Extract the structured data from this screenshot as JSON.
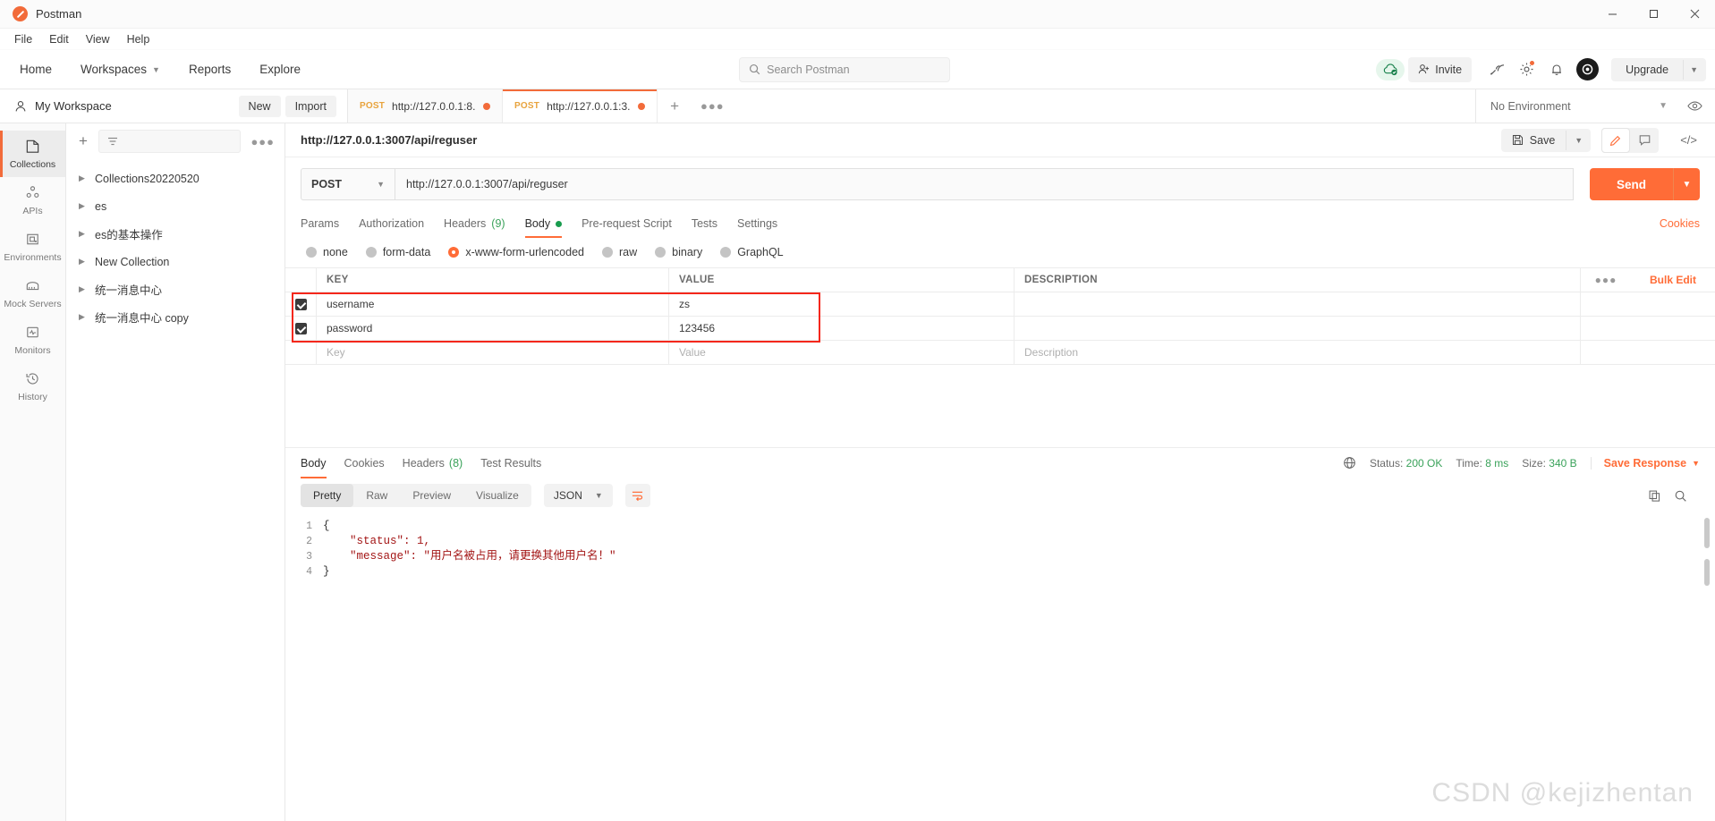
{
  "window": {
    "title": "Postman",
    "controls": {
      "minimize": "─",
      "maximize": "☐",
      "close": "✕"
    }
  },
  "menubar": {
    "items": [
      "File",
      "Edit",
      "View",
      "Help"
    ]
  },
  "navbar": {
    "links": [
      {
        "label": "Home",
        "has_chevron": false
      },
      {
        "label": "Workspaces",
        "has_chevron": true
      },
      {
        "label": "Reports",
        "has_chevron": false
      },
      {
        "label": "Explore",
        "has_chevron": false
      }
    ],
    "search_placeholder": "Search Postman",
    "invite_label": "Invite",
    "upgrade_label": "Upgrade",
    "icons": [
      "cloud-sync-icon",
      "invite-icon",
      "satellite-icon",
      "gear-icon",
      "bell-icon",
      "avatar-icon"
    ]
  },
  "workspace": {
    "name": "My Workspace",
    "new_label": "New",
    "import_label": "Import",
    "environment": "No Environment"
  },
  "request_tabs": [
    {
      "method": "POST",
      "name": "http://127.0.0.1:8...",
      "active": false,
      "unsaved": true
    },
    {
      "method": "POST",
      "name": "http://127.0.0.1:3...",
      "active": true,
      "unsaved": true
    }
  ],
  "rail": {
    "items": [
      {
        "label": "Collections",
        "icon": "collections-icon",
        "active": true
      },
      {
        "label": "APIs",
        "icon": "apis-icon",
        "active": false
      },
      {
        "label": "Environments",
        "icon": "environments-icon",
        "active": false
      },
      {
        "label": "Mock Servers",
        "icon": "mock-servers-icon",
        "active": false
      },
      {
        "label": "Monitors",
        "icon": "monitors-icon",
        "active": false
      },
      {
        "label": "History",
        "icon": "history-icon",
        "active": false
      }
    ]
  },
  "collections": {
    "filter_placeholder": "",
    "items": [
      {
        "name": "Collections20220520"
      },
      {
        "name": "es"
      },
      {
        "name": "es的基本操作"
      },
      {
        "name": "New Collection"
      },
      {
        "name": "统一消息中心"
      },
      {
        "name": "统一消息中心 copy"
      }
    ]
  },
  "request": {
    "title": "http://127.0.0.1:3007/api/reguser",
    "save_label": "Save",
    "method": "POST",
    "url": "http://127.0.0.1:3007/api/reguser",
    "send_label": "Send",
    "tabs": [
      {
        "label": "Params",
        "active": false,
        "count": null,
        "dot": false
      },
      {
        "label": "Authorization",
        "active": false,
        "count": null,
        "dot": false
      },
      {
        "label": "Headers",
        "active": false,
        "count": "(9)",
        "dot": false
      },
      {
        "label": "Body",
        "active": true,
        "count": null,
        "dot": true
      },
      {
        "label": "Pre-request Script",
        "active": false,
        "count": null,
        "dot": false
      },
      {
        "label": "Tests",
        "active": false,
        "count": null,
        "dot": false
      },
      {
        "label": "Settings",
        "active": false,
        "count": null,
        "dot": false
      }
    ],
    "cookies_link": "Cookies",
    "body_types": [
      {
        "label": "none",
        "selected": false
      },
      {
        "label": "form-data",
        "selected": false
      },
      {
        "label": "x-www-form-urlencoded",
        "selected": true
      },
      {
        "label": "raw",
        "selected": false
      },
      {
        "label": "binary",
        "selected": false
      },
      {
        "label": "GraphQL",
        "selected": false
      }
    ],
    "table": {
      "headers": {
        "key": "KEY",
        "value": "VALUE",
        "description": "DESCRIPTION"
      },
      "bulk_edit_label": "Bulk Edit",
      "rows": [
        {
          "checked": true,
          "key": "username",
          "value": "zs",
          "description": ""
        },
        {
          "checked": true,
          "key": "password",
          "value": "123456",
          "description": ""
        }
      ],
      "placeholder_row": {
        "key": "Key",
        "value": "Value",
        "description": "Description"
      }
    }
  },
  "response": {
    "tabs": [
      {
        "label": "Body",
        "active": true,
        "count": null
      },
      {
        "label": "Cookies",
        "active": false,
        "count": null
      },
      {
        "label": "Headers",
        "active": false,
        "count": "(8)"
      },
      {
        "label": "Test Results",
        "active": false,
        "count": null
      }
    ],
    "meta": {
      "status_label": "Status:",
      "status_value": "200 OK",
      "time_label": "Time:",
      "time_value": "8 ms",
      "size_label": "Size:",
      "size_value": "340 B",
      "save_response_label": "Save Response"
    },
    "format_buttons": [
      {
        "label": "Pretty",
        "active": true
      },
      {
        "label": "Raw",
        "active": false
      },
      {
        "label": "Preview",
        "active": false
      },
      {
        "label": "Visualize",
        "active": false
      }
    ],
    "language": "JSON",
    "code_lines": [
      {
        "num": "1",
        "text": "{"
      },
      {
        "num": "2",
        "text": "    \"status\": 1,"
      },
      {
        "num": "3",
        "text": "    \"message\": \"用户名被占用，请更换其他用户名！\""
      },
      {
        "num": "4",
        "text": "}"
      }
    ]
  },
  "watermark": "CSDN @kejizhentan",
  "colors": {
    "accent": "#ff6c37",
    "green": "#3aa25a",
    "annotation": "#f4271b"
  }
}
